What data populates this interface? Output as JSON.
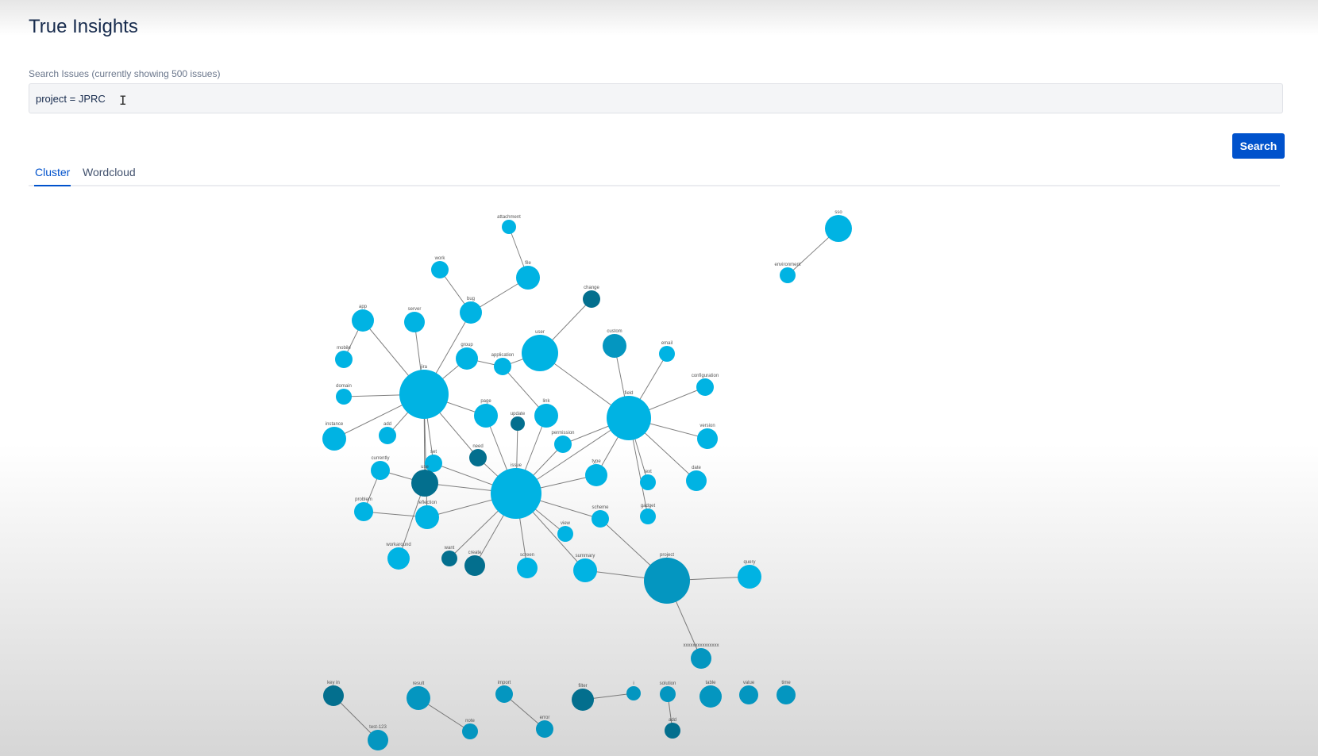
{
  "app": {
    "title": "True Insights"
  },
  "search": {
    "label": "Search Issues (currently showing 500 issues)",
    "value": "project = JPRC",
    "button_label": "Search"
  },
  "tabs": [
    {
      "label": "Cluster",
      "active": true
    },
    {
      "label": "Wordcloud",
      "active": false
    }
  ],
  "colors": {
    "node_light": "#00b3e3",
    "node_mid": "#0496c0",
    "node_dark": "#036f8e",
    "edge": "#555555",
    "primary": "#0052cc"
  },
  "graph": {
    "nodes": [
      {
        "id": "attachment",
        "label": "attachment",
        "shade": "light"
      },
      {
        "id": "file",
        "label": "file",
        "shade": "light"
      },
      {
        "id": "work",
        "label": "work",
        "shade": "light"
      },
      {
        "id": "bug",
        "label": "bug",
        "shade": "light"
      },
      {
        "id": "change",
        "label": "change",
        "shade": "dark"
      },
      {
        "id": "app",
        "label": "app",
        "shade": "light"
      },
      {
        "id": "server",
        "label": "server",
        "shade": "light"
      },
      {
        "id": "mobile",
        "label": "mobile",
        "shade": "light"
      },
      {
        "id": "group",
        "label": "group",
        "shade": "light"
      },
      {
        "id": "application",
        "label": "application",
        "shade": "light"
      },
      {
        "id": "user",
        "label": "user",
        "shade": "light"
      },
      {
        "id": "custom",
        "label": "custom",
        "shade": "mid"
      },
      {
        "id": "email",
        "label": "email",
        "shade": "light"
      },
      {
        "id": "jira",
        "label": "jira",
        "shade": "light"
      },
      {
        "id": "domain",
        "label": "domain",
        "shade": "light"
      },
      {
        "id": "configuration",
        "label": "configuration",
        "shade": "light"
      },
      {
        "id": "instance",
        "label": "instance",
        "shade": "light"
      },
      {
        "id": "add",
        "label": "add",
        "shade": "light"
      },
      {
        "id": "page",
        "label": "page",
        "shade": "light"
      },
      {
        "id": "link",
        "label": "link",
        "shade": "light"
      },
      {
        "id": "update",
        "label": "update",
        "shade": "dark"
      },
      {
        "id": "field",
        "label": "field",
        "shade": "light"
      },
      {
        "id": "version",
        "label": "version",
        "shade": "light"
      },
      {
        "id": "need",
        "label": "need",
        "shade": "dark"
      },
      {
        "id": "permission",
        "label": "permission",
        "shade": "light"
      },
      {
        "id": "currently",
        "label": "currently",
        "shade": "light"
      },
      {
        "id": "set",
        "label": "set",
        "shade": "light"
      },
      {
        "id": "issue",
        "label": "issue",
        "shade": "light"
      },
      {
        "id": "type",
        "label": "type",
        "shade": "light"
      },
      {
        "id": "text",
        "label": "text",
        "shade": "light"
      },
      {
        "id": "date",
        "label": "date",
        "shade": "light"
      },
      {
        "id": "use",
        "label": "use",
        "shade": "dark"
      },
      {
        "id": "problem",
        "label": "problem",
        "shade": "light"
      },
      {
        "id": "reflection",
        "label": "reflection",
        "shade": "light"
      },
      {
        "id": "gadget",
        "label": "gadget",
        "shade": "light"
      },
      {
        "id": "scheme",
        "label": "scheme",
        "shade": "light"
      },
      {
        "id": "view",
        "label": "view",
        "shade": "light"
      },
      {
        "id": "workaround",
        "label": "workaround",
        "shade": "light"
      },
      {
        "id": "want",
        "label": "want",
        "shade": "dark"
      },
      {
        "id": "create",
        "label": "create",
        "shade": "dark"
      },
      {
        "id": "screen",
        "label": "screen",
        "shade": "light"
      },
      {
        "id": "summary",
        "label": "summary",
        "shade": "light"
      },
      {
        "id": "project",
        "label": "project",
        "shade": "mid"
      },
      {
        "id": "query",
        "label": "query",
        "shade": "light"
      },
      {
        "id": "xxxxxxxxxxxxxxx",
        "label": "xxxxxxxxxxxxxxx",
        "shade": "mid"
      },
      {
        "id": "sso",
        "label": "sso",
        "shade": "light"
      },
      {
        "id": "environment",
        "label": "environment",
        "shade": "light"
      },
      {
        "id": "key-in",
        "label": "key in",
        "shade": "dark"
      },
      {
        "id": "test-123",
        "label": "test-123",
        "shade": "mid"
      },
      {
        "id": "result",
        "label": "result",
        "shade": "mid"
      },
      {
        "id": "note",
        "label": "note",
        "shade": "mid"
      },
      {
        "id": "import",
        "label": "import",
        "shade": "mid"
      },
      {
        "id": "error",
        "label": "error",
        "shade": "mid"
      },
      {
        "id": "filter",
        "label": "filter",
        "shade": "dark"
      },
      {
        "id": "i",
        "label": "i",
        "shade": "mid"
      },
      {
        "id": "solution",
        "label": "solution",
        "shade": "mid"
      },
      {
        "id": "add2",
        "label": "add",
        "shade": "dark"
      },
      {
        "id": "table",
        "label": "table",
        "shade": "mid"
      },
      {
        "id": "value",
        "label": "value",
        "shade": "mid"
      },
      {
        "id": "time",
        "label": "time",
        "shade": "mid"
      }
    ],
    "edges": [
      [
        "attachment",
        "file"
      ],
      [
        "file",
        "bug"
      ],
      [
        "work",
        "bug"
      ],
      [
        "bug",
        "jira"
      ],
      [
        "change",
        "user"
      ],
      [
        "app",
        "jira"
      ],
      [
        "server",
        "jira"
      ],
      [
        "mobile",
        "app"
      ],
      [
        "group",
        "jira"
      ],
      [
        "application",
        "group"
      ],
      [
        "application",
        "user"
      ],
      [
        "user",
        "field"
      ],
      [
        "custom",
        "field"
      ],
      [
        "email",
        "field"
      ],
      [
        "configuration",
        "field"
      ],
      [
        "domain",
        "jira"
      ],
      [
        "instance",
        "jira"
      ],
      [
        "add",
        "jira"
      ],
      [
        "page",
        "jira"
      ],
      [
        "link",
        "application"
      ],
      [
        "jira",
        "need"
      ],
      [
        "jira",
        "use"
      ],
      [
        "jira",
        "set"
      ],
      [
        "jira",
        "reflection"
      ],
      [
        "version",
        "field"
      ],
      [
        "date",
        "field"
      ],
      [
        "text",
        "field"
      ],
      [
        "permission",
        "field"
      ],
      [
        "type",
        "field"
      ],
      [
        "issue",
        "field"
      ],
      [
        "issue",
        "page"
      ],
      [
        "issue",
        "link"
      ],
      [
        "issue",
        "update"
      ],
      [
        "issue",
        "permission"
      ],
      [
        "issue",
        "need"
      ],
      [
        "issue",
        "use"
      ],
      [
        "issue",
        "set"
      ],
      [
        "issue",
        "reflection"
      ],
      [
        "issue",
        "type"
      ],
      [
        "issue",
        "scheme"
      ],
      [
        "issue",
        "view"
      ],
      [
        "issue",
        "want"
      ],
      [
        "issue",
        "create"
      ],
      [
        "issue",
        "screen"
      ],
      [
        "issue",
        "summary"
      ],
      [
        "currently",
        "use"
      ],
      [
        "problem",
        "reflection"
      ],
      [
        "problem",
        "currently"
      ],
      [
        "workaround",
        "use"
      ],
      [
        "scheme",
        "project"
      ],
      [
        "summary",
        "project"
      ],
      [
        "gadget",
        "field"
      ],
      [
        "project",
        "query"
      ],
      [
        "project",
        "xxxxxxxxxxxxxxx"
      ],
      [
        "sso",
        "environment"
      ],
      [
        "key-in",
        "test-123"
      ],
      [
        "result",
        "note"
      ],
      [
        "import",
        "error"
      ],
      [
        "filter",
        "i"
      ],
      [
        "solution",
        "add2"
      ]
    ]
  }
}
